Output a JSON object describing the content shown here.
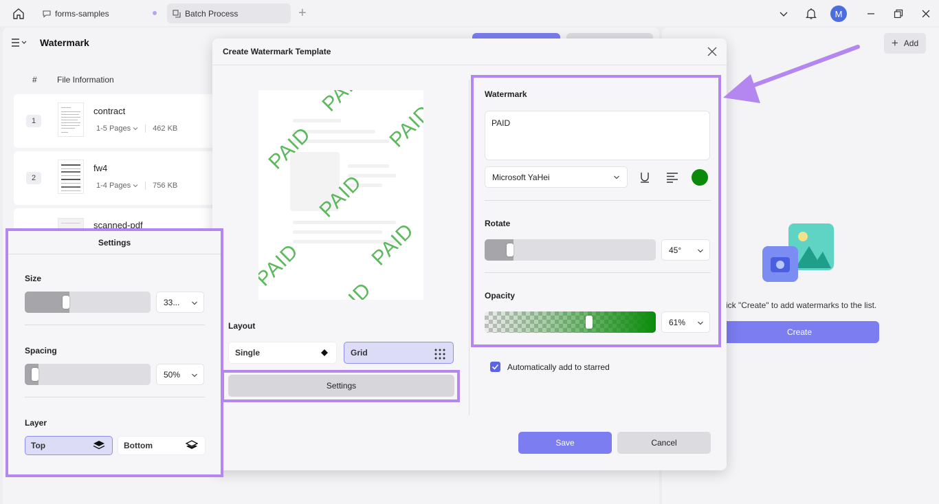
{
  "tabs": [
    {
      "label": "forms-samples"
    },
    {
      "label": "Batch Process"
    }
  ],
  "panel": {
    "title": "Watermark"
  },
  "table": {
    "headers": {
      "index": "#",
      "file": "File Information"
    },
    "rows": [
      {
        "num": "1",
        "name": "contract",
        "pages": "1-5 Pages",
        "size": "462 KB"
      },
      {
        "num": "2",
        "name": "fw4",
        "pages": "1-4 Pages",
        "size": "756 KB"
      },
      {
        "num": "",
        "name": "scanned-pdf",
        "pages": "",
        "size": ""
      }
    ]
  },
  "right": {
    "add_label": "Add",
    "empty_text": "ick \"Create\" to add watermarks to the list.",
    "create_label": "Create"
  },
  "modal": {
    "title": "Create Watermark Template",
    "watermark_label": "Watermark",
    "watermark_text": "PAID",
    "font": "Microsoft YaHei",
    "color": "#0a8a0a",
    "rotate_label": "Rotate",
    "rotate_value": "45°",
    "rotate_level": 0.15,
    "opacity_label": "Opacity",
    "opacity_value": "61%",
    "opacity_level": 0.61,
    "layout_label": "Layout",
    "layout_single": "Single",
    "layout_grid": "Grid",
    "settings_label": "Settings",
    "auto_star_label": "Automatically add to starred",
    "save_label": "Save",
    "cancel_label": "Cancel",
    "preview_texts": [
      "PAID",
      "PAID",
      "PAID",
      "PAID",
      "PAID",
      "PAID",
      "PAID",
      "PAID"
    ]
  },
  "settings_popup": {
    "title": "Settings",
    "size_label": "Size",
    "size_value": "33...",
    "size_level": 0.33,
    "spacing_label": "Spacing",
    "spacing_value": "50%",
    "spacing_level": 0.08,
    "layer_label": "Layer",
    "layer_top": "Top",
    "layer_bottom": "Bottom"
  },
  "colors": {
    "accent": "#7b7df0",
    "highlight": "#b386f0",
    "watermark_green": "#3fae3f"
  },
  "icons": [
    "home-icon",
    "chat-icon",
    "batch-icon",
    "plus-icon",
    "chevron-down-icon",
    "bell-icon",
    "minimize-icon",
    "restore-icon",
    "close-icon",
    "menu-icon",
    "underline-icon",
    "align-icon",
    "diamond-icon",
    "grid-icon",
    "layers-icon",
    "check-icon"
  ]
}
